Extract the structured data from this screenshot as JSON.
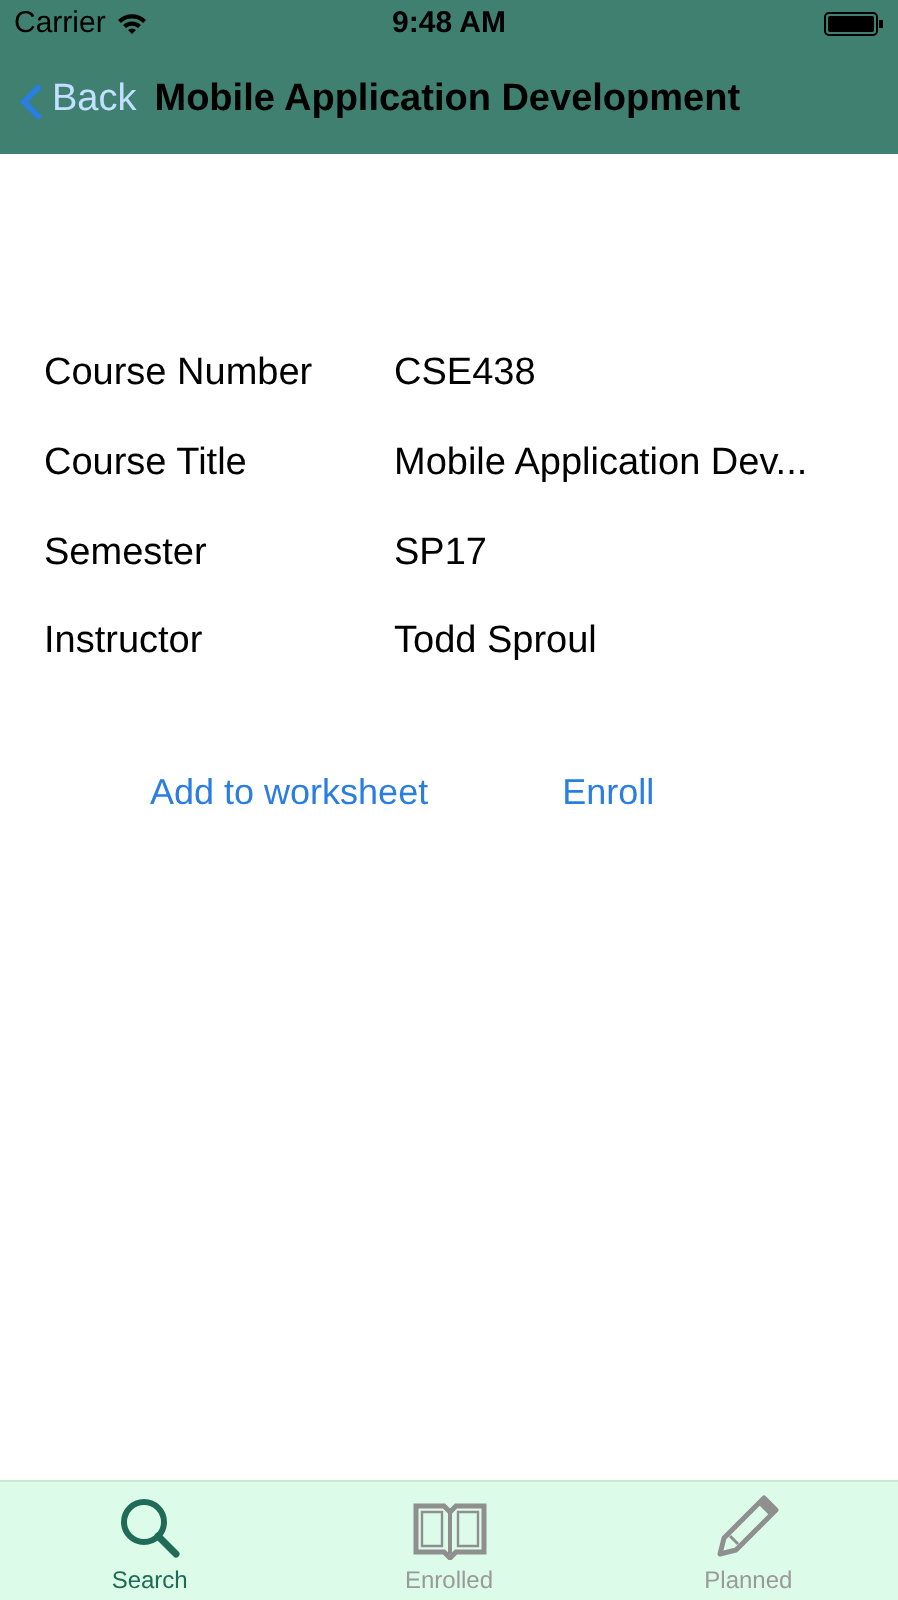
{
  "status_bar": {
    "carrier": "Carrier",
    "time": "9:48 AM"
  },
  "nav_bar": {
    "back": "Back",
    "title": "Mobile Application Development"
  },
  "details": [
    {
      "label": "Course Number",
      "value": "CSE438"
    },
    {
      "label": "Course Title",
      "value": "Mobile Application Dev..."
    },
    {
      "label": "Semester",
      "value": "SP17"
    },
    {
      "label": "Instructor",
      "value": "Todd Sproul"
    }
  ],
  "actions": [
    "Add to worksheet",
    "Enroll"
  ],
  "tab_bar": [
    {
      "kind": "search",
      "label": "Search",
      "selected": true
    },
    {
      "kind": "book",
      "label": "Enrolled",
      "selected": false
    },
    {
      "kind": "pencil",
      "label": "Planned",
      "selected": false
    }
  ]
}
